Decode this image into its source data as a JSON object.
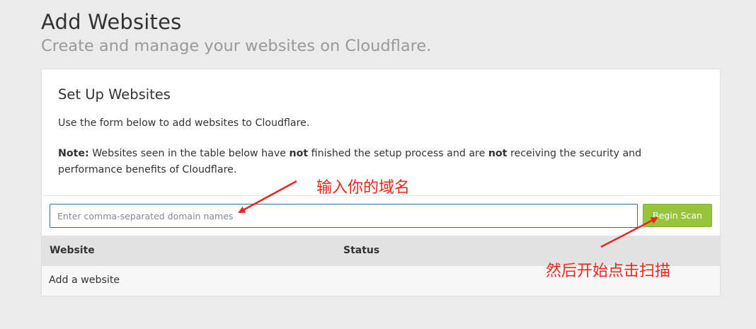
{
  "header": {
    "title": "Add Websites",
    "subtitle": "Create and manage your websites on Cloudflare."
  },
  "card": {
    "title": "Set Up Websites",
    "description": "Use the form below to add websites to Cloudflare.",
    "note": {
      "label": "Note:",
      "part1": " Websites seen in the table below have ",
      "bold1": "not",
      "part2": " finished the setup process and are ",
      "bold2": "not",
      "part3": " receiving the security and performance benefits of Cloudflare."
    }
  },
  "form": {
    "input_placeholder": "Enter comma-separated domain names",
    "input_value": "",
    "scan_button_label": "Begin Scan"
  },
  "table": {
    "columns": [
      "Website",
      "Status"
    ],
    "rows": [
      {
        "website": "Add a website",
        "status": ""
      }
    ]
  },
  "annotations": {
    "input_hint": "输入你的域名",
    "button_hint": "然后开始点击扫描",
    "color": "#e8261c"
  },
  "colors": {
    "background": "#ebebeb",
    "button_green": "#97c43c",
    "input_border": "#2f6f9f"
  }
}
